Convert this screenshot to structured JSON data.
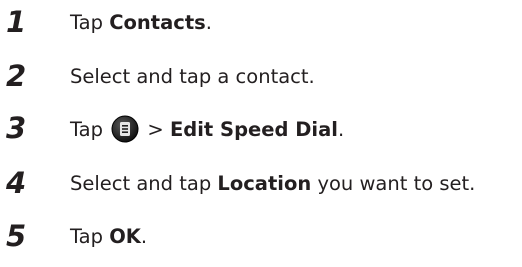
{
  "steps": [
    {
      "number": "1",
      "prefix": "Tap ",
      "bold": "Contacts",
      "suffix": "."
    },
    {
      "number": "2",
      "text": "Select and tap a contact."
    },
    {
      "number": "3",
      "prefix": "Tap",
      "separator": " > ",
      "bold": "Edit Speed Dial",
      "suffix": ".",
      "icon": "menu-icon"
    },
    {
      "number": "4",
      "prefix": "Select and tap ",
      "bold": "Location",
      "suffix": " you want to set."
    },
    {
      "number": "5",
      "prefix": "Tap ",
      "bold": "OK",
      "suffix": "."
    }
  ],
  "colors": {
    "text": "#231f20",
    "icon_dark": "#1a1a1a",
    "icon_light": "#e6e6e6"
  }
}
